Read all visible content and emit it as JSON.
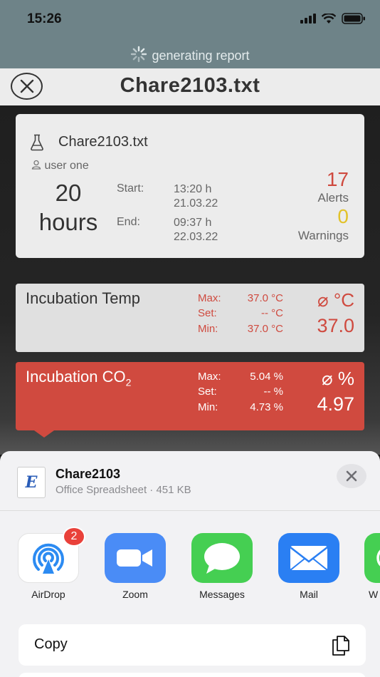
{
  "status": {
    "time": "15:26"
  },
  "banner": {
    "text": "generating report"
  },
  "header": {
    "title": "Chare2103.txt"
  },
  "summary": {
    "filename": "Chare2103.txt",
    "user": "user one",
    "duration_value": "20",
    "duration_unit": "hours",
    "start_label": "Start:",
    "start_time": "13:20 h",
    "start_date": "21.03.22",
    "end_label": "End:",
    "end_time": "09:37 h",
    "end_date": "22.03.22",
    "alerts_count": "17",
    "alerts_label": "Alerts",
    "warnings_count": "0",
    "warnings_label": "Warnings"
  },
  "metrics": [
    {
      "name": "Incubation Temp",
      "max_label": "Max:",
      "max": "37.0 °C",
      "set_label": "Set:",
      "set": "-- °C",
      "min_label": "Min:",
      "min": "37.0 °C",
      "unit": "⌀ °C",
      "avg": "37.0"
    },
    {
      "name_prefix": "Incubation CO",
      "name_sub": "2",
      "max_label": "Max:",
      "max": "5.04 %",
      "set_label": "Set:",
      "set": "-- %",
      "min_label": "Min:",
      "min": "4.73 %",
      "unit": "⌀ %",
      "avg": "4.97"
    }
  ],
  "share": {
    "file_name": "Chare2103",
    "file_meta": "Office Spreadsheet · 451 KB",
    "file_icon_letter": "E",
    "apps": [
      {
        "label": "AirDrop",
        "badge": "2"
      },
      {
        "label": "Zoom"
      },
      {
        "label": "Messages"
      },
      {
        "label": "Mail"
      },
      {
        "label": "W"
      }
    ],
    "action_copy": "Copy"
  },
  "colors": {
    "alert_red": "#cf4a3f",
    "warning_yellow": "#e2c22a",
    "header_teal": "#6e8388"
  }
}
